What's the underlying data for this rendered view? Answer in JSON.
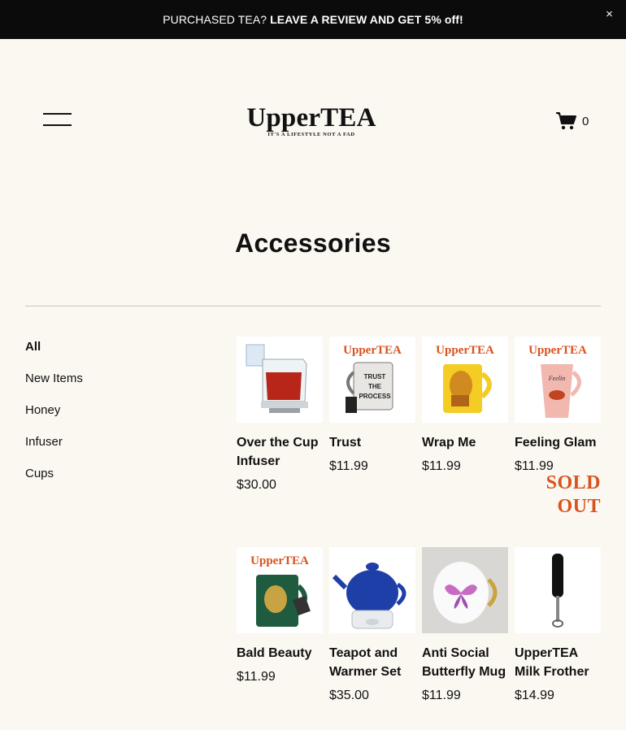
{
  "announcement": {
    "plain": "PURCHASED TEA?",
    "strong": "LEAVE A REVIEW AND GET 5% off!",
    "close": "×"
  },
  "header": {
    "logo_name": "UpperTEA",
    "logo_tagline": "IT'S A LIFESTYLE NOT A FAD",
    "cart_count": "0"
  },
  "page": {
    "title": "Accessories"
  },
  "categories": [
    "All",
    "New Items",
    "Honey",
    "Infuser",
    "Cups"
  ],
  "active_category": "All",
  "products": [
    {
      "title": "Over the Cup Infuser",
      "price": "$30.00",
      "icon": "infuser-image"
    },
    {
      "title": "Trust",
      "price": "$11.99",
      "icon": "mug-image"
    },
    {
      "title": "Wrap Me",
      "price": "$11.99",
      "icon": "mug-image"
    },
    {
      "title": "Feeling Glam",
      "price": "$11.99",
      "icon": "mug-image",
      "sold_out_line1": "SOLD",
      "sold_out_line2": "OUT"
    },
    {
      "title": "Bald Beauty",
      "price": "$11.99",
      "icon": "mug-image"
    },
    {
      "title": "Teapot and Warmer Set",
      "price": "$35.00",
      "icon": "teapot-image"
    },
    {
      "title": "Anti Social Butterfly Mug",
      "price": "$11.99",
      "icon": "mug-image"
    },
    {
      "title": "UpperTEA Milk Frother",
      "price": "$14.99",
      "icon": "frother-image"
    }
  ],
  "colors": {
    "accent": "#d9531e",
    "background": "#fbf8f2",
    "bar": "#0b0b0b"
  }
}
